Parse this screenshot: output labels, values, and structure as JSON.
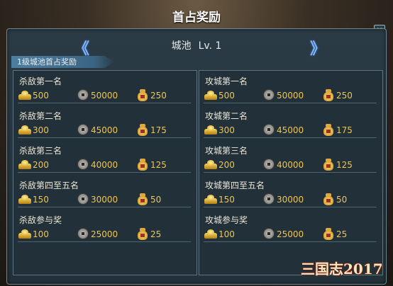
{
  "window": {
    "title": "首占奖励",
    "close_label": "×"
  },
  "header": {
    "city": "城池",
    "level": "Lv. 1",
    "prev_label": "《",
    "next_label": "》"
  },
  "subheader": "1级城池首占奖励",
  "kill_rewards": [
    {
      "label": "杀敌第一名",
      "gold": "500",
      "coins": "50000",
      "bag": "250"
    },
    {
      "label": "杀敌第二名",
      "gold": "300",
      "coins": "45000",
      "bag": "175"
    },
    {
      "label": "杀敌第三名",
      "gold": "200",
      "coins": "40000",
      "bag": "125"
    },
    {
      "label": "杀敌第四至五名",
      "gold": "150",
      "coins": "30000",
      "bag": "50"
    },
    {
      "label": "杀敌参与奖",
      "gold": "100",
      "coins": "25000",
      "bag": "25"
    }
  ],
  "siege_rewards": [
    {
      "label": "攻城第一名",
      "gold": "500",
      "coins": "50000",
      "bag": "250"
    },
    {
      "label": "攻城第二名",
      "gold": "300",
      "coins": "45000",
      "bag": "175"
    },
    {
      "label": "攻城第三名",
      "gold": "200",
      "coins": "40000",
      "bag": "125"
    },
    {
      "label": "攻城第四至五名",
      "gold": "150",
      "coins": "30000",
      "bag": "50"
    },
    {
      "label": "攻城参与奖",
      "gold": "100",
      "coins": "25000",
      "bag": "25"
    }
  ],
  "icons": {
    "gold": "gold-ingot-icon",
    "coins": "copper-coin-icon",
    "bag": "money-bag-icon"
  },
  "logo_text": "三国志2017"
}
